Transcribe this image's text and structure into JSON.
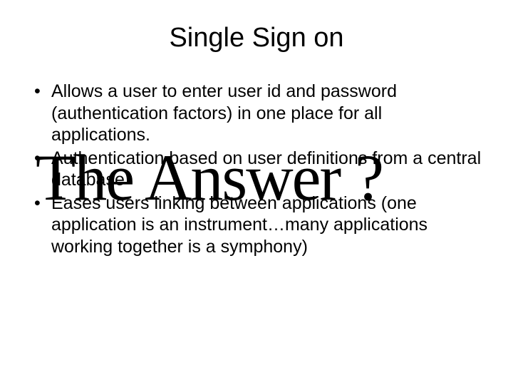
{
  "slide": {
    "title": "Single Sign on",
    "bullets": [
      "Allows a user to enter user id and password (authentication factors) in one place for all applications.",
      "Authentication based on user definitions from a central database",
      "Eases users linking between applications (one application is an instrument…many applications working together is a symphony)"
    ],
    "overlay": "The Answer ?"
  }
}
